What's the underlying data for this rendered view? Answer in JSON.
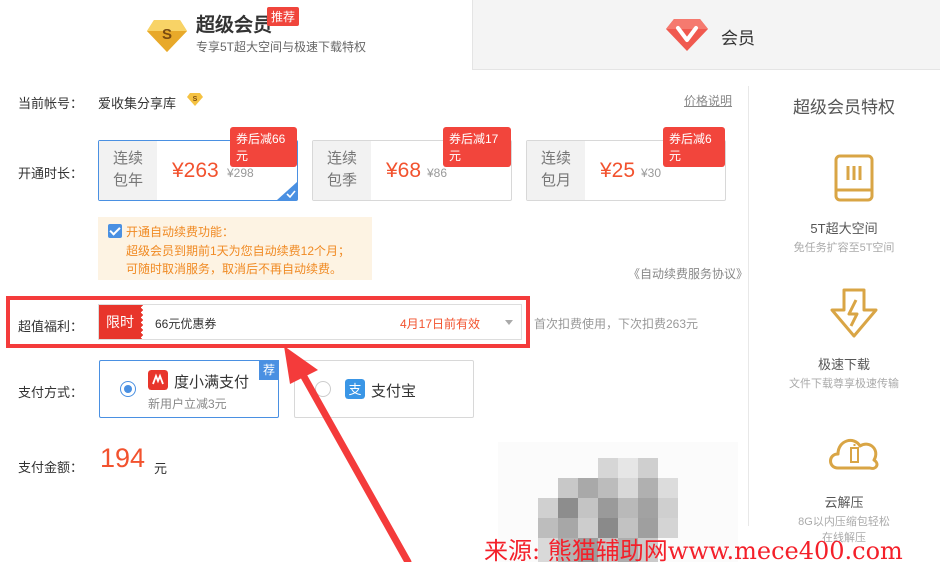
{
  "tabs": {
    "super": {
      "title": "超级会员",
      "badge": "推荐",
      "subtitle": "专享5T超大空间与极速下载特权",
      "icon": "s-gem-icon"
    },
    "vip": {
      "title": "会员",
      "icon": "v-gem-icon"
    }
  },
  "account": {
    "label": "当前帐号：",
    "name": "爱收集分享库",
    "price_link": "价格说明"
  },
  "duration": {
    "label": "开通时长：",
    "plans": [
      {
        "line1": "连续",
        "line2": "包年",
        "price": "¥263",
        "original": "¥298",
        "tag": "券后减66元",
        "selected": true
      },
      {
        "line1": "连续",
        "line2": "包季",
        "price": "¥68",
        "original": "¥86",
        "tag": "券后减17元",
        "selected": false
      },
      {
        "line1": "连续",
        "line2": "包月",
        "price": "¥25",
        "original": "¥30",
        "tag": "券后减6元",
        "selected": false
      }
    ]
  },
  "auto_renew": {
    "line1": "开通自动续费功能：",
    "line2": "超级会员到期前1天为您自动续费12个月；",
    "line3": "可随时取消服务，取消后不再自动续费。",
    "agreement": "《自动续费服务协议》"
  },
  "benefit": {
    "label": "超值福利：",
    "limit": "限时",
    "coupon": "66元优惠券",
    "expire": "4月17日前有效",
    "note": "首次扣费使用，下次扣费263元"
  },
  "payment": {
    "label": "支付方式：",
    "methods": [
      {
        "name": "度小满支付",
        "sub": "新用户立减3元",
        "badge": "荐",
        "selected": true,
        "color": "#e8352b"
      },
      {
        "name": "支付宝",
        "selected": false,
        "color": "#3a96e6"
      }
    ]
  },
  "amount": {
    "label": "支付金额：",
    "value": "194",
    "unit": "元"
  },
  "features": {
    "title": "超级会员特权",
    "items": [
      {
        "name": "5T超大空间",
        "desc": "免任务扩容至5T空间",
        "icon": "storage-icon"
      },
      {
        "name": "极速下载",
        "desc": "文件下载尊享极速传输",
        "icon": "download-icon"
      },
      {
        "name": "云解压",
        "desc": "8G以内压缩包轻松",
        "desc2": "在线解压",
        "icon": "cloud-unzip-icon"
      }
    ]
  },
  "watermark": "来源: 熊猫辅助网www.mece400.com",
  "colors": {
    "accent": "#4a90e2",
    "price": "#f2522e",
    "highlight": "#f43b3b",
    "gold": "#e0a43a"
  }
}
